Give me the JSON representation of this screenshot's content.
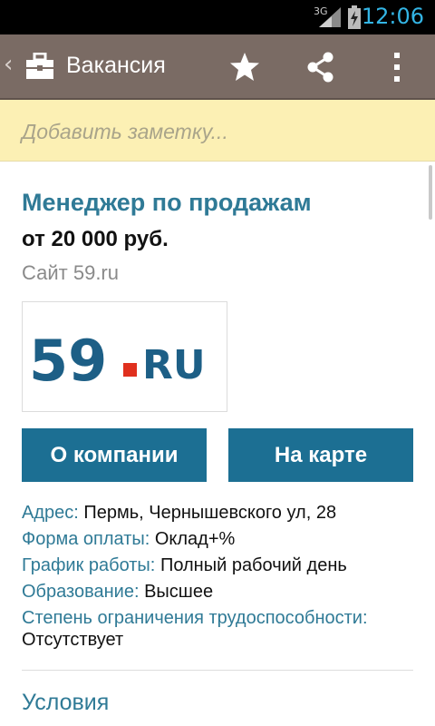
{
  "status_bar": {
    "network": "3G",
    "time": "12:06",
    "clock_color": "#33b5e5"
  },
  "action_bar": {
    "title": "Вакансия",
    "icons": [
      "up-chevron",
      "briefcase-icon",
      "star-icon",
      "share-icon",
      "overflow-menu-icon"
    ],
    "background": "#7a6b64"
  },
  "note": {
    "placeholder": "Добавить заметку..."
  },
  "vacancy": {
    "title": "Менеджер по продажам",
    "salary": "от 20 000 руб.",
    "source": "Сайт 59.ru",
    "logo": {
      "number": "59",
      "suffix": "RU",
      "dot_color": "#e0301e",
      "text_color": "#1d5f86"
    },
    "title_color": "#2f7a96"
  },
  "buttons": {
    "company": "О компании",
    "map": "На карте",
    "color": "#1c6f93"
  },
  "details": [
    {
      "key": "Адрес:",
      "value": "Пермь, Чернышевского ул, 28"
    },
    {
      "key": "Форма оплаты:",
      "value": "Оклад+%"
    },
    {
      "key": "График работы:",
      "value": "Полный рабочий день"
    },
    {
      "key": "Образование:",
      "value": "Высшее"
    },
    {
      "key": "Степень ограничения трудоспособности:",
      "value": "Отсутствует"
    }
  ],
  "sections": {
    "conditions": "Условия"
  }
}
